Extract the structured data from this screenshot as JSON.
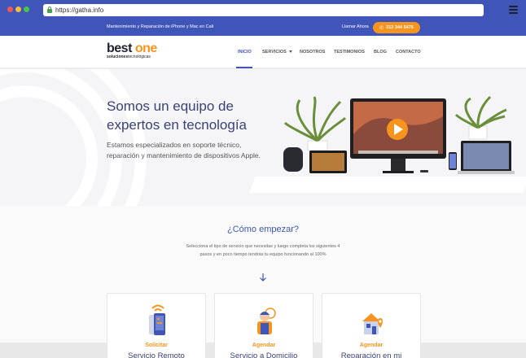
{
  "browser": {
    "url": "https://gatha.info"
  },
  "top_strip": {
    "tagline": "Mantenimiento y Reparación de iPhone y Mac en Cali",
    "call_label": "Llamar Ahora",
    "phone": "312 344 5476"
  },
  "logo": {
    "best": "best",
    "one": "one",
    "sub_bold": "soluciones",
    "sub_rest": "tecnológicas"
  },
  "nav": {
    "items": [
      {
        "label": "INICIO"
      },
      {
        "label": "SERVICIOS"
      },
      {
        "label": "NOSOTROS"
      },
      {
        "label": "TESTIMONIOS"
      },
      {
        "label": "BLOG"
      },
      {
        "label": "CONTACTO"
      }
    ]
  },
  "hero": {
    "title_line1": "Somos un equipo de",
    "title_line2": "expertos en tecnología",
    "description": "Estamos especializados en soporte técnico, reparación y mantenimiento de dispositivos Apple."
  },
  "how": {
    "title": "¿Cómo empezar?",
    "description": "Selecciona el tipo de servicio que necesitas y luego completa los siguientes 4 pasos y en poco tiempo tendrás tu equipo funcionando al 100%"
  },
  "cards": [
    {
      "verb": "Solicitar",
      "title": "Servicio Remoto",
      "icon": "remote-phone-icon"
    },
    {
      "verb": "Agendar",
      "title": "Servicio a Domicilio",
      "icon": "technician-icon"
    },
    {
      "verb": "Agendar",
      "title": "Reparación en mi",
      "icon": "house-location-icon"
    }
  ],
  "colors": {
    "brand_blue": "#3f56b8",
    "accent_orange": "#f7941d",
    "title_navy": "#3a4277"
  }
}
